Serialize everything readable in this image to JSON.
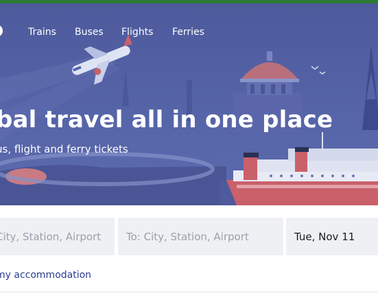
{
  "colors": {
    "top_bar": "#2d7a34",
    "hero_background": "#5463a7",
    "text_on_hero": "#ffffff",
    "field_background": "#eef0f3",
    "link_text": "#2a3b8f"
  },
  "nav": {
    "logo_icon": "logo-ring-icon",
    "items": [
      {
        "label": "Trains"
      },
      {
        "label": "Buses"
      },
      {
        "label": "Flights"
      },
      {
        "label": "Ferries"
      }
    ]
  },
  "hero": {
    "title": "bal travel all in one place",
    "subtitle": "us, flight and ferry tickets",
    "illustration_icons": [
      "airplane-icon",
      "domed-building-icon",
      "eiffel-tower-icon",
      "ferry-ship-icon",
      "birds-icon"
    ]
  },
  "search": {
    "from_placeholder": "City, Station, Airport",
    "to_placeholder": "To: City, Station, Airport",
    "date_value": "Tue, Nov 11"
  },
  "accommodation": {
    "label": "my accommodation"
  }
}
